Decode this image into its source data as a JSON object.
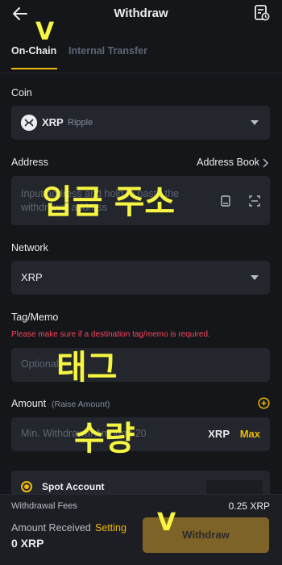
{
  "header": {
    "title": "Withdraw"
  },
  "tabs": [
    {
      "label": "On-Chain"
    },
    {
      "label": "Internal Transfer"
    }
  ],
  "coin": {
    "label": "Coin",
    "symbol": "XRP",
    "name": "Ripple"
  },
  "address": {
    "label": "Address",
    "address_book": "Address Book",
    "placeholder": "Input address and hold to paste the withdrawal address"
  },
  "network": {
    "label": "Network",
    "value": "XRP"
  },
  "tag": {
    "label": "Tag/Memo",
    "warning": "Please make sure if a destination tag/memo is required.",
    "placeholder": "Optional"
  },
  "amount": {
    "label": "Amount",
    "raise": "(Raise Amount)",
    "placeholder": "Min. Withdrawal Amount: 20",
    "currency": "XRP",
    "max": "Max"
  },
  "account": {
    "label": "Spot Account"
  },
  "footer": {
    "fees_label": "Withdrawal Fees",
    "fees_value": "0.25 XRP",
    "received_label": "Amount Received",
    "setting": "Setting",
    "received_value": "0 XRP",
    "withdraw_button": "Withdraw"
  },
  "annotations": {
    "v_top": "V",
    "address_note": "입금 주소",
    "tag_note": "태그",
    "amount_note": "수량",
    "v_button": "V"
  },
  "colors": {
    "accent": "#f0b90b",
    "background": "#14161a",
    "field": "#23262c",
    "warning": "#f6465d",
    "annotation": "#f5f542"
  }
}
